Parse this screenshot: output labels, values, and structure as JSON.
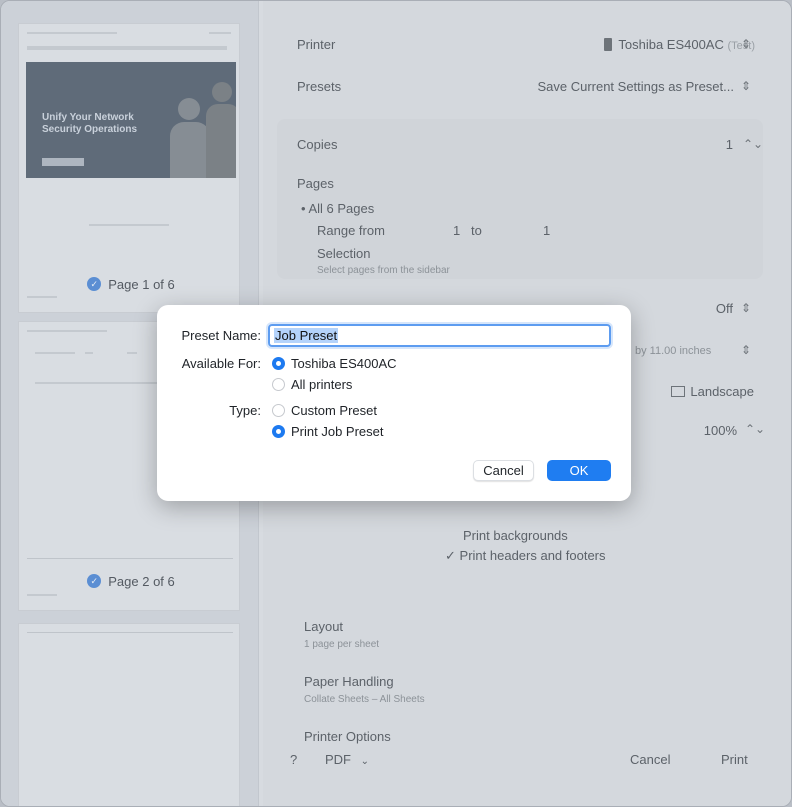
{
  "print_dialog": {
    "printer": {
      "label": "Printer",
      "value": "Toshiba ES400AC",
      "suffix": "(Test)"
    },
    "presets": {
      "label": "Presets",
      "value": "Save Current Settings as Preset..."
    },
    "copies": {
      "label": "Copies",
      "value": "1"
    },
    "pages": {
      "label": "Pages",
      "all": "All 6 Pages",
      "range_label": "Range from",
      "range_from": "1",
      "range_to_label": "to",
      "range_to": "1",
      "selection": "Selection",
      "selection_hint": "Select pages from the sidebar"
    },
    "two_sided": {
      "value": "Off"
    },
    "paper_size_value": "by 11.00 inches",
    "orientation": {
      "value": "Landscape"
    },
    "scale": {
      "value": "100%"
    },
    "print_backgrounds": "Print backgrounds",
    "print_headers_footers": "Print headers and footers",
    "layout": {
      "label": "Layout",
      "sub": "1 page per sheet"
    },
    "paper_handling": {
      "label": "Paper Handling",
      "sub": "Collate Sheets – All Sheets"
    },
    "printer_options": {
      "label": "Printer Options"
    },
    "bottom": {
      "help": "?",
      "pdf": "PDF",
      "cancel": "Cancel",
      "print": "Print"
    }
  },
  "sidebar": {
    "thumb1": {
      "hero_text": "Unify Your Network Security Operations",
      "page_label": "Page 1 of 6"
    },
    "thumb2": {
      "page_label": "Page 2 of 6"
    }
  },
  "modal": {
    "preset_name_label": "Preset Name:",
    "preset_name_value": "Job Preset",
    "available_for_label": "Available For:",
    "available_options": [
      {
        "label": "Toshiba ES400AC",
        "selected": true
      },
      {
        "label": "All printers",
        "selected": false
      }
    ],
    "type_label": "Type:",
    "type_options": [
      {
        "label": "Custom Preset",
        "selected": false
      },
      {
        "label": "Print Job Preset",
        "selected": true
      }
    ],
    "cancel": "Cancel",
    "ok": "OK"
  },
  "colors": {
    "accent": "#1f7df1",
    "dim_bg": "#d4d8dd"
  }
}
